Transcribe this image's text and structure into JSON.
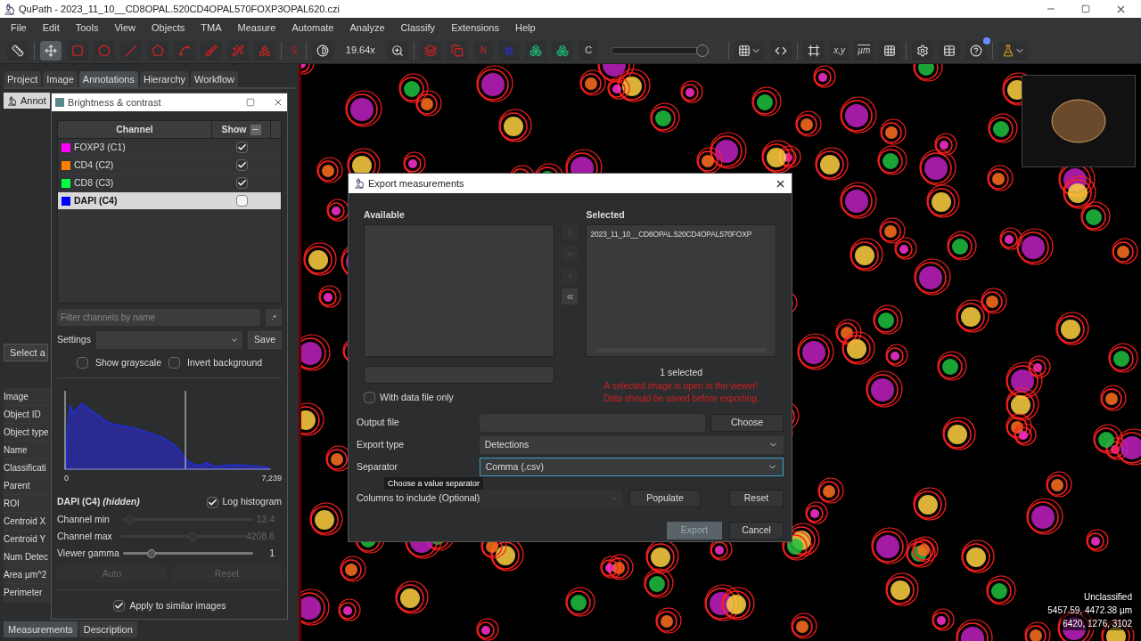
{
  "window": {
    "title": "QuPath - 2023_11_10__CD8OPAL.520CD4OPAL570FOXP3OPAL620.czi"
  },
  "menu": [
    "File",
    "Edit",
    "Tools",
    "View",
    "Objects",
    "TMA",
    "Measure",
    "Automate",
    "Analyze",
    "Classify",
    "Extensions",
    "Help"
  ],
  "toolbar": {
    "tools": [
      {
        "selected": false
      },
      {
        "selected": true
      },
      {
        "selected": false
      },
      {
        "selected": false
      },
      {
        "selected": false
      },
      {
        "selected": false
      },
      {
        "selected": false
      },
      {
        "selected": false
      },
      {
        "selected": false
      },
      {
        "selected": false
      }
    ],
    "s_label": "S",
    "zoom": "19.64x",
    "n_label": "N",
    "c_label": "C",
    "opacity": {
      "level": 1
    },
    "xy_label": "x,y",
    "um_label": "µm",
    "help_notification": true
  },
  "left_panel": {
    "tabs": [
      {
        "label": "Project",
        "selected": false
      },
      {
        "label": "Image",
        "selected": false
      },
      {
        "label": "Annotations",
        "selected": true
      },
      {
        "label": "Hierarchy",
        "selected": false
      },
      {
        "label": "Workflow",
        "selected": false
      }
    ],
    "annotation_tab": "Annot",
    "select_button": "Select a",
    "properties": [
      "Image",
      "Object ID",
      "Object type",
      "Name",
      "Classificati",
      "Parent",
      "ROI",
      "Centroid X",
      "Centroid Y",
      "Num Detec",
      "Area µm^2",
      "Perimeter"
    ],
    "bottom_tabs": [
      {
        "label": "Measurements",
        "selected": true
      },
      {
        "label": "Description",
        "selected": false
      }
    ]
  },
  "brightness": {
    "title": "Brightness & contrast",
    "columns": [
      "Channel",
      "Show"
    ],
    "channels": [
      {
        "name": "FOXP3 (C1)",
        "color": "#ff00ff",
        "shown": true,
        "selected": false
      },
      {
        "name": "CD4 (C2)",
        "color": "#ff8000",
        "shown": true,
        "selected": false
      },
      {
        "name": "CD8 (C3)",
        "color": "#00ff40",
        "shown": true,
        "selected": false
      },
      {
        "name": "DAPI (C4)",
        "color": "#0000ff",
        "shown": false,
        "selected": true
      }
    ],
    "filter_placeholder": "Filter channels by name",
    "regex_button": ".*",
    "settings_label": "Settings",
    "save": "Save",
    "show_grayscale": {
      "label": "Show grayscale",
      "checked": false
    },
    "invert_background": {
      "label": "Invert background",
      "checked": false
    },
    "histogram": {
      "x_min": "0",
      "x_max": "7,239"
    },
    "channel_label": "DAPI (C4) *(hidden)*",
    "log_histogram": {
      "label": "Log histogram",
      "checked": true
    },
    "sliders": [
      {
        "label": "Channel min",
        "level": 0.02,
        "reading": "13.4",
        "disabled": true
      },
      {
        "label": "Channel max",
        "level": 0.58,
        "reading": "4208.6",
        "disabled": true
      },
      {
        "label": "Viewer gamma",
        "level": 0.2,
        "reading": "1",
        "disabled": false
      }
    ],
    "auto": "Auto",
    "reset": "Reset",
    "apply_similar": {
      "label": "Apply to similar images",
      "checked": true
    }
  },
  "export": {
    "title": "Export measurements",
    "available_label": "Available",
    "selected_label": "Selected",
    "selected_items": [
      "2023_11_10__CD8OPAL.520CD4OPAL570FOXP"
    ],
    "transfer_buttons": [
      {
        "disabled": true
      },
      {
        "disabled": true
      },
      {
        "disabled": true
      },
      {
        "disabled": false
      }
    ],
    "selected_count": "1 selected",
    "warnings": [
      "A selected image is open in the viewer!",
      "Data should be saved before exporting."
    ],
    "with_data_file": {
      "label": "With data file only",
      "checked": false
    },
    "output_file_label": "Output file",
    "choose": "Choose",
    "export_type_label": "Export type",
    "export_type": "Detections",
    "separator_label": "Separator",
    "separator": "Comma (.csv)",
    "columns_label": "Columns to include (Optional)",
    "populate": "Populate",
    "reset": "Reset",
    "tooltip": "Choose a value separator",
    "export_button": "Export",
    "cancel": "Cancel"
  },
  "viewer": {
    "info": [
      "Unclassified",
      "5457.59, 4472.38 µm",
      "6420, 1276, 3102"
    ]
  }
}
